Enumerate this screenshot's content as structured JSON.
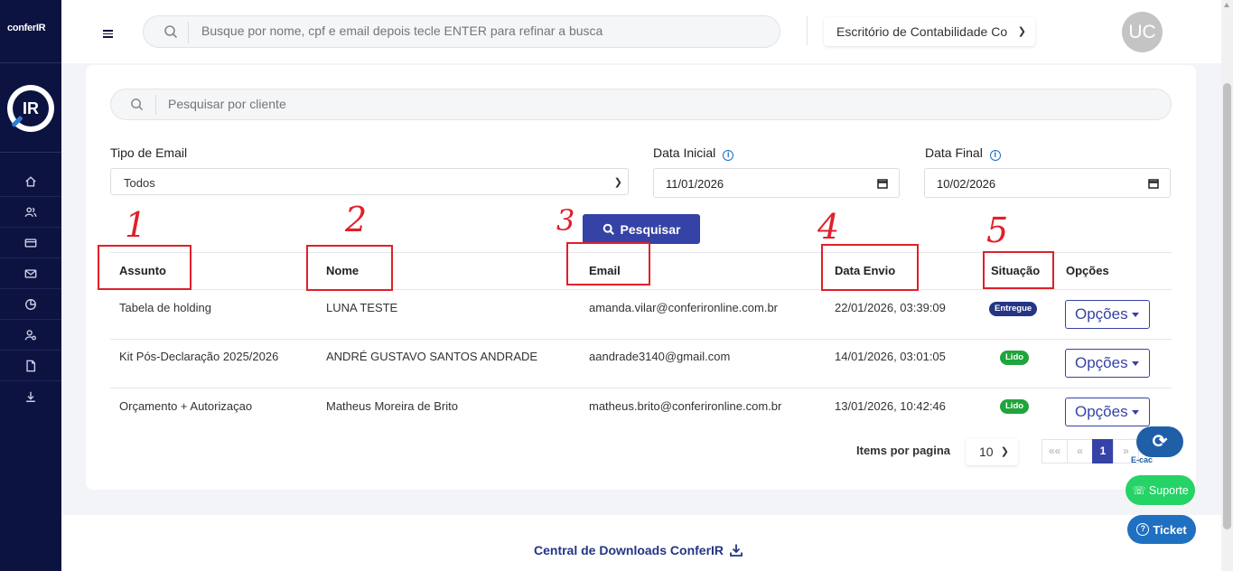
{
  "sidebar": {
    "brand": "conferIR",
    "logo_text": "IR",
    "nav": [
      {
        "icon": "home-icon"
      },
      {
        "icon": "users-icon"
      },
      {
        "icon": "card-icon"
      },
      {
        "icon": "mail-icon"
      },
      {
        "icon": "pie-chart-icon"
      },
      {
        "icon": "user-settings-icon"
      },
      {
        "icon": "document-icon"
      },
      {
        "icon": "download-icon"
      }
    ]
  },
  "topbar": {
    "search_placeholder": "Busque por nome, cpf e email depois tecle ENTER para refinar a busca",
    "office_select": "Escritório de Contabilidade Co",
    "avatar_initials": "UC"
  },
  "filters": {
    "client_search_placeholder": "Pesquisar por cliente",
    "tipo_email_label": "Tipo de Email",
    "tipo_email_value": "Todos",
    "data_inicial_label": "Data Inicial",
    "data_inicial_value": "11/01/2026",
    "data_final_label": "Data Final",
    "data_final_value": "10/02/2026",
    "search_button": "Pesquisar"
  },
  "table": {
    "headers": [
      "Assunto",
      "Nome",
      "Email",
      "Data Envio",
      "Situação",
      "Opções"
    ],
    "rows": [
      {
        "assunto": "Tabela de holding",
        "nome": "LUNA TESTE",
        "email": "amanda.vilar@conferironline.com.br",
        "data": "22/01/2026, 03:39:09",
        "situacao": "Entregue",
        "opcoes": "Opções"
      },
      {
        "assunto": "Kit Pós-Declaração 2025/2026",
        "nome": "ANDRÉ GUSTAVO SANTOS ANDRADE",
        "email": "aandrade3140@gmail.com",
        "data": "14/01/2026, 03:01:05",
        "situacao": "Lido",
        "opcoes": "Opções"
      },
      {
        "assunto": "Orçamento + Autorizaçao",
        "nome": "Matheus Moreira de Brito",
        "email": "matheus.brito@conferironline.com.br",
        "data": "13/01/2026, 10:42:46",
        "situacao": "Lido",
        "opcoes": "Opções"
      }
    ]
  },
  "annotations": [
    "1",
    "2",
    "3",
    "4",
    "5"
  ],
  "pagination": {
    "label": "Items por pagina",
    "per_page": "10",
    "first": "««",
    "prev": "«",
    "current": "1",
    "next": "»"
  },
  "floating": {
    "ecac_label": "E-cac",
    "suporte": "Suporte",
    "ticket": "Ticket"
  },
  "footer": {
    "downloads_link": "Central de Downloads ConferIR"
  },
  "colors": {
    "sidebar_bg": "#0d1340",
    "primary": "#3542a6",
    "badge_entregue": "#233584",
    "badge_lido": "#20a43c",
    "annotation": "#e0202a"
  }
}
